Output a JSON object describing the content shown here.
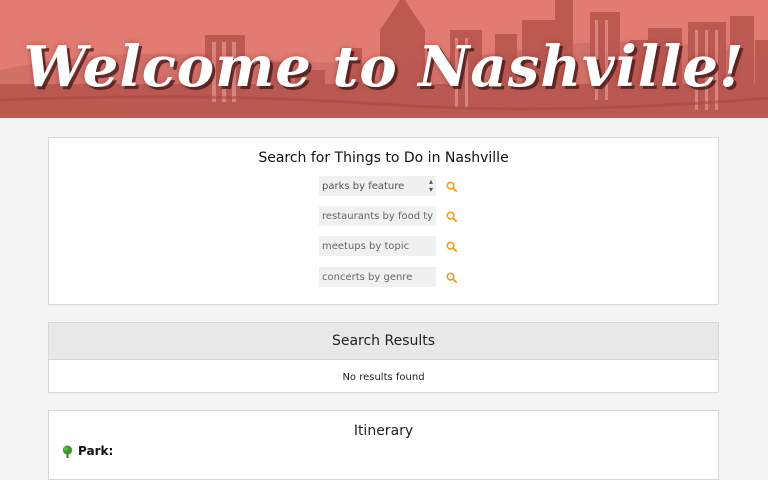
{
  "hero": {
    "title": "Welcome to Nashville!"
  },
  "search": {
    "title": "Search for Things to Do in Nashville",
    "parks_select_value": "parks by feature",
    "restaurants_placeholder": "restaurants by food type",
    "meetups_placeholder": "meetups by topic",
    "concerts_placeholder": "concerts by genre"
  },
  "results": {
    "title": "Search Results",
    "empty_text": "No results found"
  },
  "itinerary": {
    "title": "Itinerary",
    "park_label": "Park:"
  },
  "colors": {
    "accent": "#f0a020",
    "hero_tint": "#d9695f",
    "card_border": "#d7d7d7",
    "page_bg": "#f4f4f4"
  },
  "icons": [
    "search-icon",
    "tree-icon",
    "chevron-down-icon"
  ]
}
